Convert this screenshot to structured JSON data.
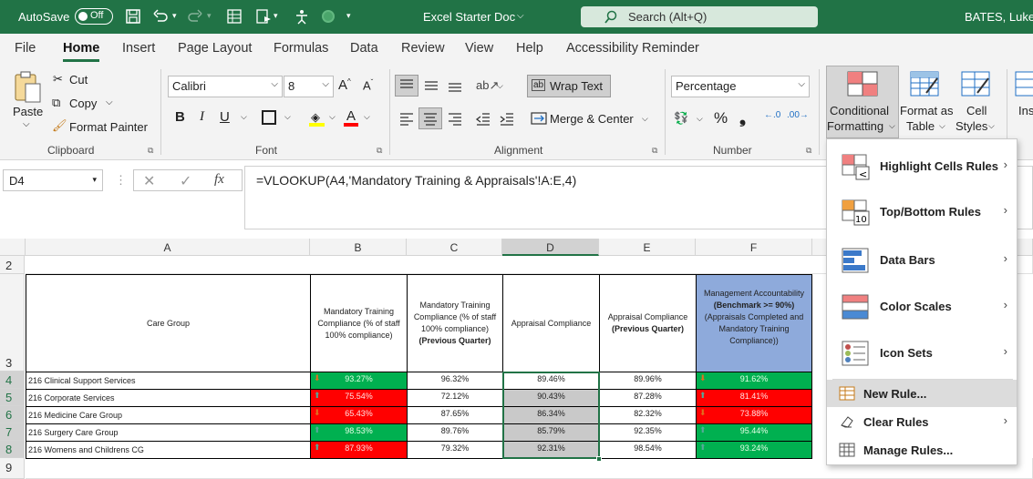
{
  "titlebar": {
    "autosave_label": "AutoSave",
    "autosave_state": "Off",
    "doc_title": "Excel Starter Doc",
    "search_placeholder": "Search (Alt+Q)",
    "user_name": "BATES, Luke"
  },
  "tabs": [
    "File",
    "Home",
    "Insert",
    "Page Layout",
    "Formulas",
    "Data",
    "Review",
    "View",
    "Help",
    "Accessibility Reminder"
  ],
  "ribbon": {
    "clipboard": {
      "paste": "Paste",
      "cut": "Cut",
      "copy": "Copy",
      "format_painter": "Format Painter",
      "group": "Clipboard"
    },
    "font": {
      "name": "Calibri",
      "size": "8",
      "group": "Font"
    },
    "alignment": {
      "wrap_text": "Wrap Text",
      "merge_center": "Merge & Center",
      "group": "Alignment"
    },
    "number": {
      "format": "Percentage",
      "group": "Number"
    },
    "styles": {
      "conditional_l1": "Conditional",
      "conditional_l2": "Formatting",
      "format_as_l1": "Format as",
      "format_as_l2": "Table",
      "cell_styles_l1": "Cell",
      "cell_styles_l2": "Styles",
      "insert_partial": "Ins"
    }
  },
  "formula_bar": {
    "name_box": "D4",
    "formula": "=VLOOKUP(A4,'Mandatory Training & Appraisals'!A:E,4)"
  },
  "grid": {
    "columns": [
      "A",
      "B",
      "C",
      "D",
      "E",
      "F"
    ],
    "row_numbers": [
      "2",
      "3",
      "4",
      "5",
      "6",
      "7",
      "8",
      "9"
    ],
    "header_row": {
      "a": "Care Group",
      "b": "Mandatory Training Compliance (% of staff 100% compliance)",
      "c_main": "Mandatory Training Compliance (% of staff 100% compliance)",
      "c_bold": "(Previous Quarter)",
      "d": "Appraisal Compliance",
      "e_main": "Appraisal Compliance",
      "e_bold": "(Previous Quarter)",
      "f_pre": "Management Accountability ",
      "f_bold": "(Benchmark >= 90%)",
      "f_post": " (Appraisals Completed and Mandatory Training Compliance))"
    },
    "rows": [
      {
        "name": "216 Clinical Support Services",
        "b": "93.27%",
        "b_color": "green",
        "b_arrow": "down",
        "c": "96.32%",
        "d": "89.46%",
        "d_color": "none",
        "e": "89.96%",
        "f": "91.62%",
        "f_color": "green",
        "f_arrow": "down"
      },
      {
        "name": "216 Corporate Services",
        "b": "75.54%",
        "b_color": "red",
        "b_arrow": "up",
        "c": "72.12%",
        "d": "90.43%",
        "d_color": "grey",
        "e": "87.28%",
        "f": "81.41%",
        "f_color": "red",
        "f_arrow": "up"
      },
      {
        "name": "216 Medicine Care Group",
        "b": "65.43%",
        "b_color": "red",
        "b_arrow": "down",
        "c": "87.65%",
        "d": "86.34%",
        "d_color": "grey",
        "e": "82.32%",
        "f": "73.88%",
        "f_color": "red",
        "f_arrow": "down"
      },
      {
        "name": "216 Surgery Care Group",
        "b": "98.53%",
        "b_color": "green",
        "b_arrow": "up",
        "c": "89.76%",
        "d": "85.79%",
        "d_color": "grey",
        "e": "92.35%",
        "f": "95.44%",
        "f_color": "green",
        "f_arrow": "up"
      },
      {
        "name": "216 Womens and Childrens CG",
        "b": "87.93%",
        "b_color": "red",
        "b_arrow": "up",
        "c": "79.32%",
        "d": "92.31%",
        "d_color": "grey",
        "e": "98.54%",
        "f": "93.24%",
        "f_color": "green",
        "f_arrow": "up"
      }
    ]
  },
  "cf_menu": {
    "items": [
      {
        "label": "Highlight Cells Rules",
        "u": "H"
      },
      {
        "label": "Top/Bottom Rules",
        "u": "T"
      },
      {
        "label": "Data Bars",
        "u": "D"
      },
      {
        "label": "Color Scales",
        "u": "S"
      },
      {
        "label": "Icon Sets",
        "u": "I"
      }
    ],
    "new_rule": "New Rule...",
    "clear_rules": "Clear Rules",
    "manage_rules": "Manage Rules..."
  },
  "colors": {
    "excel_green": "#217346",
    "cf_red": "#ff0000",
    "cf_green": "#00b050",
    "cf_grey": "#c9c9c9",
    "header_blue": "#8eaadb"
  }
}
